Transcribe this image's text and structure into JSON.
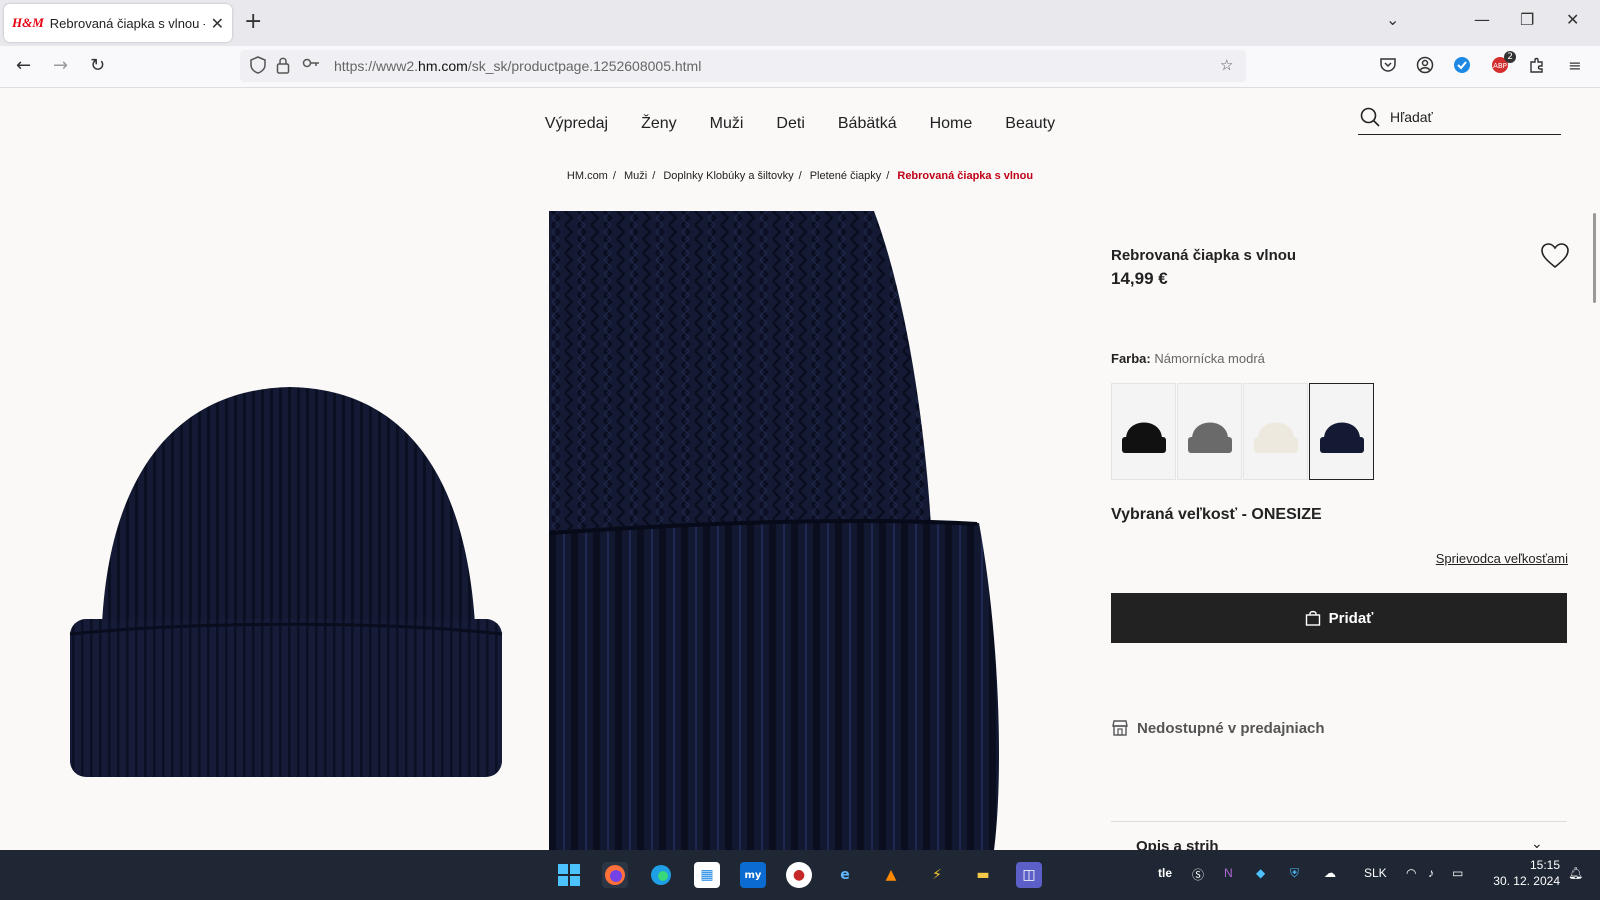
{
  "browser": {
    "tab_title": "Rebrovaná čiapka s vlnou - Čie",
    "tab_favicon": "H&M",
    "url_prefix": "https://www2.",
    "url_domain": "hm.com",
    "url_path": "/sk_sk/productpage.1252608005.html",
    "extension_badge": "2"
  },
  "site": {
    "nav": [
      "Výpredaj",
      "Ženy",
      "Muži",
      "Deti",
      "Bábätká",
      "Home",
      "Beauty"
    ],
    "search_placeholder": "Hľadať",
    "breadcrumb": [
      "HM.com",
      "Muži",
      "Doplnky Klobúky a šiltovky",
      "Pletené čiapky"
    ],
    "breadcrumb_current": "Rebrovaná čiapka s vlnou"
  },
  "product": {
    "title": "Rebrovaná čiapka s vlnou",
    "price": "14,99 €",
    "color_label": "Farba:",
    "color_value": "Námornícka modrá",
    "swatches": [
      {
        "color": "#111111"
      },
      {
        "color": "#6a6a6a"
      },
      {
        "color": "#ede9df"
      },
      {
        "color": "#141a33",
        "selected": true
      }
    ],
    "size_title": "Vybraná veľkosť - ONESIZE",
    "size_guide": "Sprievodca veľkosťami",
    "add_button": "Pridať",
    "store_availability": "Nedostupné v predajniach",
    "description_label": "Opis a strih"
  },
  "taskbar": {
    "lang": "SLK",
    "time": "15:15",
    "date": "30. 12. 2024"
  },
  "colors": {
    "accent_red": "#c00016",
    "button_dark": "#222222",
    "hat_navy": "#141a33"
  }
}
